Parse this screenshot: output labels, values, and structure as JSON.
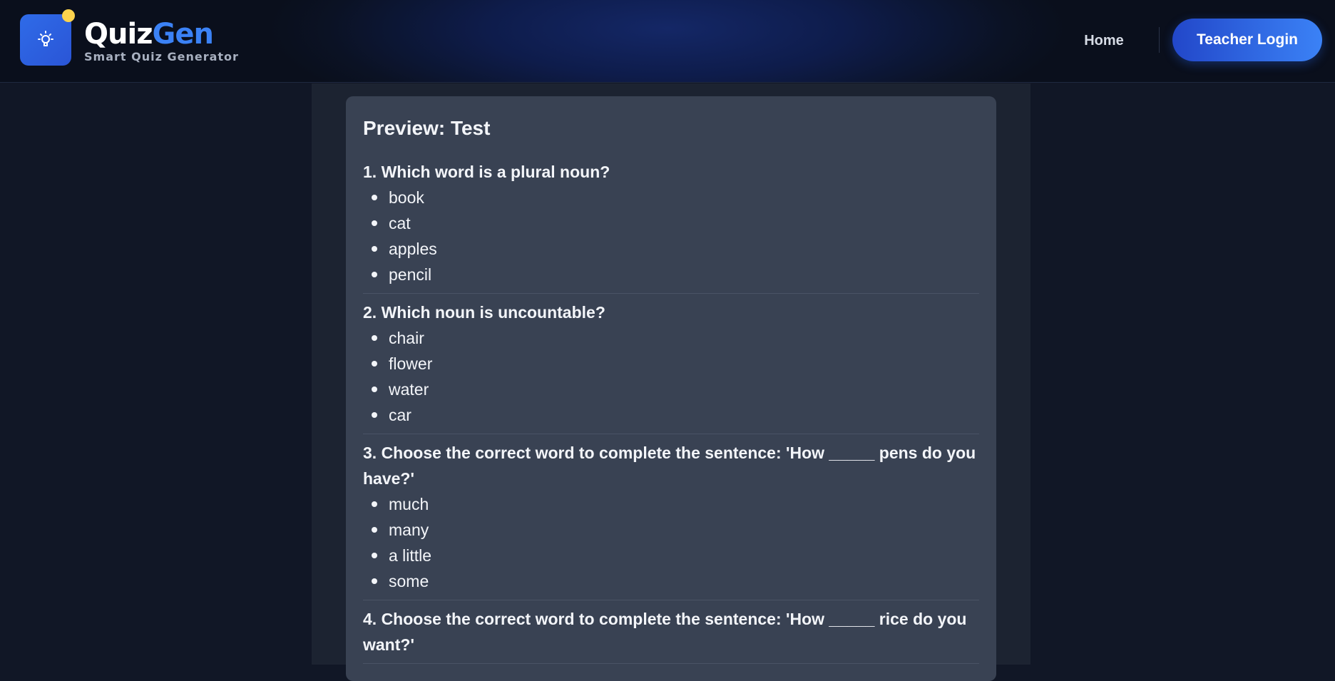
{
  "app": {
    "brand_quiz": "Quiz",
    "brand_gen": "Gen",
    "tagline": "Smart Quiz Generator",
    "logo_icon": "lightbulb-icon"
  },
  "nav": {
    "home_label": "Home",
    "login_label": "Teacher Login"
  },
  "preview": {
    "title": "Preview: Test",
    "questions": [
      {
        "text": "1. Which word is a plural noun?",
        "options": [
          "book",
          "cat",
          "apples",
          "pencil"
        ]
      },
      {
        "text": "2. Which noun is uncountable?",
        "options": [
          "chair",
          "flower",
          "water",
          "car"
        ]
      },
      {
        "text": "3. Choose the correct word to complete the sentence: 'How _____ pens do you have?'",
        "options": [
          "much",
          "many",
          "a little",
          "some"
        ]
      },
      {
        "text": "4. Choose the correct word to complete the sentence: 'How _____ rice do you want?'",
        "options": []
      }
    ]
  },
  "colors": {
    "accent": "#3b82f6",
    "badge_dot": "#fcd34d",
    "page_bg": "#111726",
    "card_bg": "#394253"
  }
}
